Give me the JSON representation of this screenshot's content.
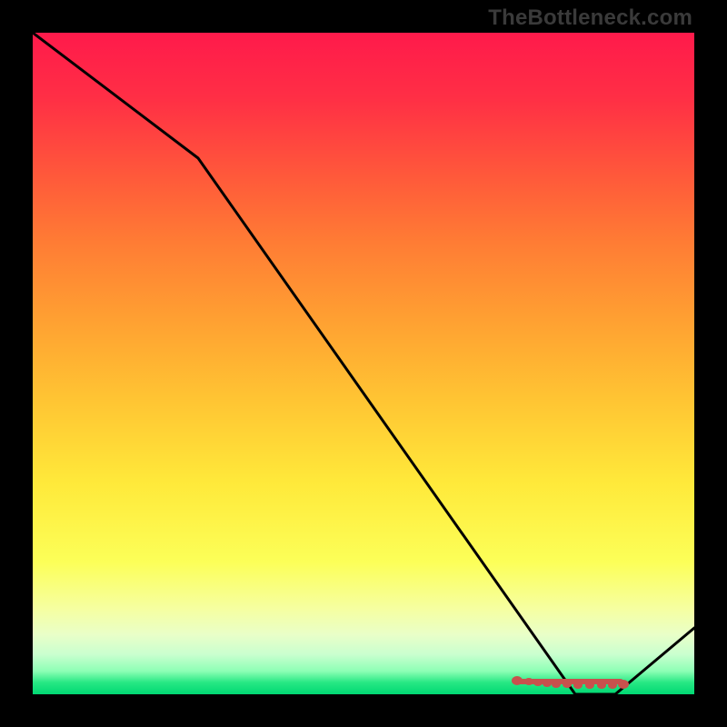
{
  "attribution": "TheBottleneck.com",
  "chart_data": {
    "type": "line",
    "title": "",
    "xlabel": "",
    "ylabel": "",
    "x": [
      0,
      25,
      82,
      88,
      100
    ],
    "values": [
      100,
      81,
      0,
      0,
      10
    ],
    "xlim": [
      0,
      100
    ],
    "ylim": [
      0,
      100
    ],
    "grid": false,
    "background": "heat-gradient",
    "markers": {
      "x_start": 73,
      "x_end": 90,
      "y": 2,
      "color": "#c8514d"
    }
  }
}
